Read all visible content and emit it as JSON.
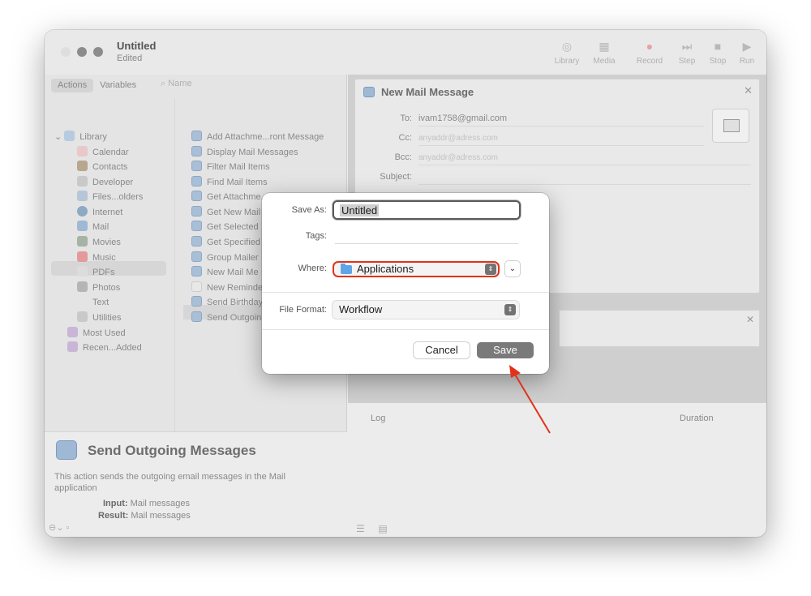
{
  "window": {
    "title": "Untitled",
    "subtitle": "Edited"
  },
  "toolbar": [
    {
      "label": "Library",
      "icon": "library-icon"
    },
    {
      "label": "Media",
      "icon": "media-icon"
    },
    {
      "label": "Record",
      "icon": "record-icon"
    },
    {
      "label": "Step",
      "icon": "step-icon"
    },
    {
      "label": "Stop",
      "icon": "stop-icon"
    },
    {
      "label": "Run",
      "icon": "run-icon"
    }
  ],
  "left_tabs": {
    "actions": "Actions",
    "variables": "Variables",
    "search_placeholder": "Name"
  },
  "library": [
    "Library",
    "Calendar",
    "Contacts",
    "Developer",
    "Files...olders",
    "Internet",
    "Mail",
    "Movies",
    "Music",
    "PDFs",
    "Photos",
    "Text",
    "Utilities",
    "Most Used",
    "Recen...Added"
  ],
  "actions_list": [
    "Add Attachme...ront Message",
    "Display Mail Messages",
    "Filter Mail Items",
    "Find Mail Items",
    "Get Attachme...Mail Messages",
    "Get New Mail",
    "Get Selected",
    "Get Specified",
    "Group Mailer",
    "New Mail Me",
    "New Reminde",
    "Send Birthday",
    "Send Outgoin"
  ],
  "description": {
    "title": "Send Outgoing Messages",
    "text": "This action sends the outgoing email messages in the Mail application",
    "input_label": "Input:",
    "input_value": "Mail messages",
    "result_label": "Result:",
    "result_value": "Mail messages"
  },
  "mail": {
    "title": "New Mail Message",
    "to_label": "To:",
    "to_value": "ivam1758@gmail.com",
    "cc_label": "Cc:",
    "cc_placeholder": "anyaddr@adress.com",
    "bcc_label": "Bcc:",
    "bcc_placeholder": "anyaddr@adress.com",
    "subject_label": "Subject:"
  },
  "log": {
    "log_label": "Log",
    "duration_label": "Duration"
  },
  "dialog": {
    "save_as_label": "Save As:",
    "save_as_value": "Untitled",
    "tags_label": "Tags:",
    "where_label": "Where:",
    "where_value": "Applications",
    "format_label": "File Format:",
    "format_value": "Workflow",
    "cancel": "Cancel",
    "save": "Save"
  },
  "colors": {
    "highlight": "#e2321b",
    "folder": "#5ea5e8"
  }
}
